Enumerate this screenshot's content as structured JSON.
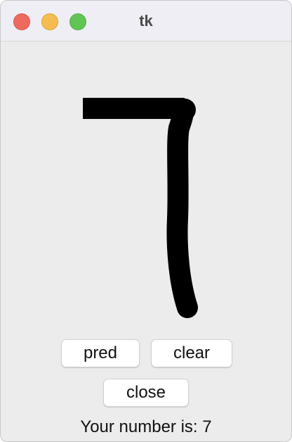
{
  "window": {
    "title": "tk"
  },
  "buttons": {
    "pred": "pred",
    "clear": "clear",
    "close": "close"
  },
  "result": {
    "text": "Your number is: 7"
  },
  "colors": {
    "close_dot": "#ee6a5f",
    "minimize_dot": "#f5bd4f",
    "maximize_dot": "#61c554",
    "stroke": "#000000"
  }
}
